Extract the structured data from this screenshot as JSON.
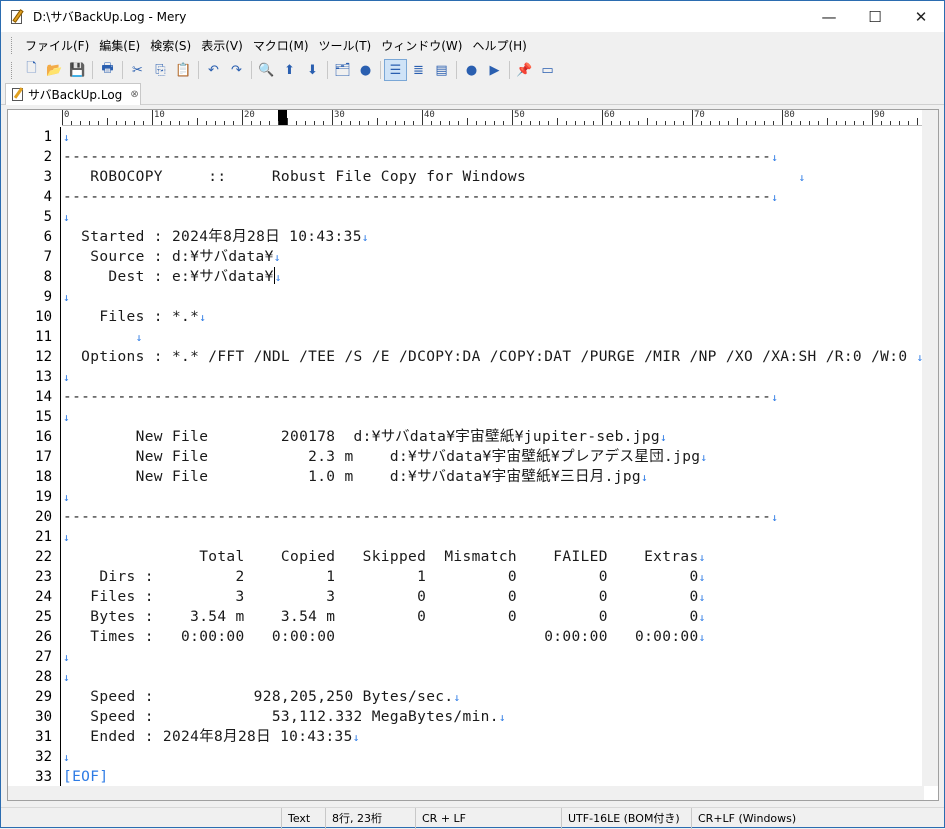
{
  "window": {
    "title": "D:\\サバBackUp.Log - Mery",
    "controls": {
      "minimize": "—",
      "maximize": "☐",
      "close": "✕"
    }
  },
  "menu": [
    "ファイル(F)",
    "編集(E)",
    "検索(S)",
    "表示(V)",
    "マクロ(M)",
    "ツール(T)",
    "ウィンドウ(W)",
    "ヘルプ(H)"
  ],
  "toolbar": [
    {
      "name": "new-file-icon",
      "glyph": "🗋"
    },
    {
      "name": "open-folder-icon",
      "glyph": "📂"
    },
    {
      "name": "save-icon",
      "glyph": "💾"
    },
    {
      "sep": true
    },
    {
      "name": "print-icon",
      "glyph": "🖶"
    },
    {
      "sep": true
    },
    {
      "name": "cut-icon",
      "glyph": "✂"
    },
    {
      "name": "copy-icon",
      "glyph": "⎘"
    },
    {
      "name": "paste-icon",
      "glyph": "📋"
    },
    {
      "sep": true
    },
    {
      "name": "undo-icon",
      "glyph": "↶"
    },
    {
      "name": "redo-icon",
      "glyph": "↷"
    },
    {
      "sep": true
    },
    {
      "name": "find-icon",
      "glyph": "🔍"
    },
    {
      "name": "find-prev-icon",
      "glyph": "⬆"
    },
    {
      "name": "find-next-icon",
      "glyph": "⬇"
    },
    {
      "sep": true
    },
    {
      "name": "find-in-files-icon",
      "glyph": "🗂"
    },
    {
      "name": "clear-highlight-icon",
      "glyph": "●"
    },
    {
      "sep": true
    },
    {
      "name": "no-wrap-icon",
      "glyph": "☰",
      "active": true
    },
    {
      "name": "wrap-window-icon",
      "glyph": "≣"
    },
    {
      "name": "wrap-ruler-icon",
      "glyph": "▤"
    },
    {
      "sep": true
    },
    {
      "name": "record-macro-icon",
      "glyph": "●"
    },
    {
      "name": "run-macro-icon",
      "glyph": "▶"
    },
    {
      "sep": true
    },
    {
      "name": "pin-icon",
      "glyph": "📌"
    },
    {
      "name": "window-icon",
      "glyph": "▭"
    }
  ],
  "tab": {
    "label": "サバBackUp.Log",
    "close": "⊗"
  },
  "ruler": {
    "marks": [
      "0",
      "10",
      "20",
      "30",
      "40",
      "50",
      "60",
      "70",
      "80",
      "90"
    ]
  },
  "editor": {
    "lines": [
      "",
      "------------------------------------------------------------------------------",
      "   ROBOCOPY     ::     Robust File Copy for Windows                              ",
      "------------------------------------------------------------------------------",
      "",
      "  Started : 2024年8月28日 10:43:35",
      "   Source : d:¥サバdata¥",
      "     Dest : e:¥サバdata¥",
      "",
      "    Files : *.*",
      "\t    ",
      "  Options : *.* /FFT /NDL /TEE /S /E /DCOPY:DA /COPY:DAT /PURGE /MIR /NP /XO /XA:SH /R:0 /W:0 ",
      "",
      "------------------------------------------------------------------------------",
      "",
      "\t    New File  \t\t200178\td:¥サバdata¥宇宙壁紙¥jupiter-seb.jpg",
      "\t    New File  \t\t   2.3 m\td:¥サバdata¥宇宙壁紙¥プレアデス星団.jpg",
      "\t    New File  \t\t   1.0 m\td:¥サバdata¥宇宙壁紙¥三日月.jpg",
      "",
      "------------------------------------------------------------------------------",
      "",
      "               Total    Copied   Skipped  Mismatch    FAILED    Extras",
      "    Dirs :         2         1         1         0         0         0",
      "   Files :         3         3         0         0         0         0",
      "   Bytes :    3.54 m    3.54 m         0         0         0         0",
      "   Times :   0:00:00   0:00:00                       0:00:00   0:00:00",
      "",
      "",
      "   Speed :           928,205,250 Bytes/sec.",
      "   Speed :             53,112.332 MegaBytes/min.",
      "   Ended : 2024年8月28日 10:43:35",
      "",
      "[EOF]"
    ],
    "eol_mark": "↓"
  },
  "status": {
    "mode": "Text",
    "position": "8行, 23桁",
    "line_ending": "CR + LF",
    "encoding": "UTF-16LE (BOM付き)",
    "newline": "CR+LF (Windows)"
  }
}
